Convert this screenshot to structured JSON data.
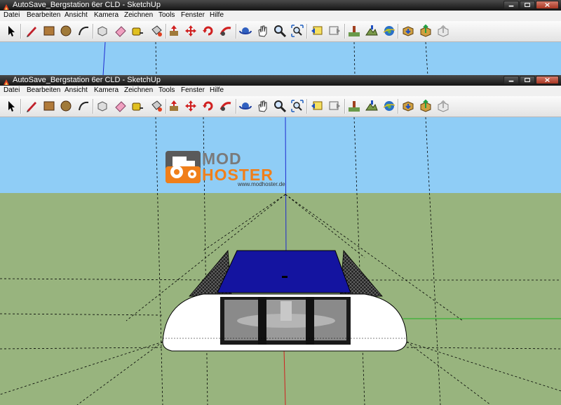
{
  "app": {
    "title": "AutoSave_Bergstation 6er CLD - SketchUp"
  },
  "menus": [
    "Datei",
    "Bearbeiten",
    "Ansicht",
    "Kamera",
    "Zeichnen",
    "Tools",
    "Fenster",
    "Hilfe"
  ],
  "toolbar_icons": [
    "select-icon",
    "pencil-line-icon",
    "rectangle-icon",
    "circle-icon",
    "arc-icon",
    "make-component-icon",
    "eraser-icon",
    "tape-measure-icon",
    "paint-bucket-icon",
    "push-pull-icon",
    "move-icon",
    "rotate-icon",
    "follow-me-icon",
    "orbit-icon",
    "pan-icon",
    "zoom-icon",
    "zoom-extents-icon",
    "previous-view-icon",
    "next-view-icon",
    "add-location-icon",
    "toggle-terrain-icon",
    "google-earth-icon",
    "get-models-icon",
    "share-model-icon",
    "share-component-icon"
  ],
  "watermark": {
    "line1": "MOD",
    "line2": "HOSTER",
    "url": "www.modhoster.de"
  },
  "colors": {
    "sky": "#8fcdf6",
    "ground": "#98b47e",
    "roof": "#1414a0",
    "logo_orange": "#f07f1a"
  }
}
